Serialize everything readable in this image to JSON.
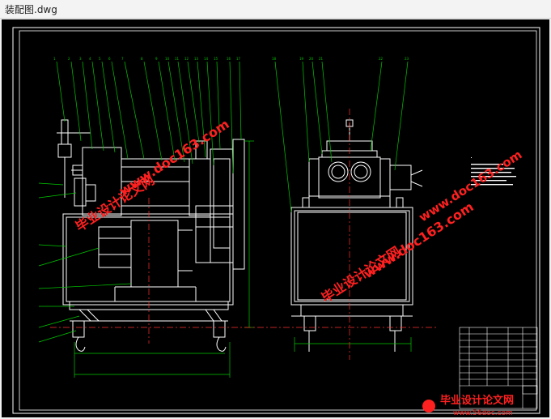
{
  "window": {
    "title": "装配图.dwg"
  },
  "watermark": {
    "cn": "毕业设计论文网",
    "url": "www.doc163.com",
    "brand_cn": "毕业设计论文网",
    "brand_url": "www.56doc.com"
  },
  "colors": {
    "background": "#000000",
    "lines": "#ffffff",
    "leaders": "#00c800",
    "center": "#ff3030",
    "watermark": "#ff2020"
  }
}
